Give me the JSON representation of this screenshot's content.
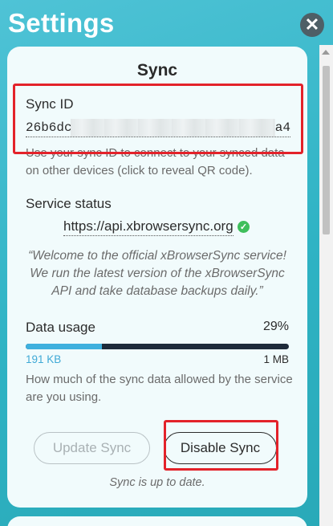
{
  "page_title": "Settings",
  "close_icon": "close-icon",
  "colors": {
    "background": "#2fb3c4",
    "card": "#f1fbfc",
    "accent": "#3fb0de",
    "highlight": "#e3222a",
    "success": "#3fbf5c"
  },
  "sync": {
    "title": "Sync",
    "sync_id_label": "Sync ID",
    "sync_id_start": "26b6dc",
    "sync_id_end": "a4",
    "sync_id_help": "Use your sync ID to connect to your synced data on other devices (click to reveal QR code).",
    "service_status_label": "Service status",
    "service_url": "https://api.xbrowsersync.org",
    "service_message": "“Welcome to the official xBrowserSync service! We run the latest version of the xBrowserSync API and take database backups daily.”",
    "data_usage_label": "Data usage",
    "data_usage_percent": "29%",
    "data_usage_fraction": 0.29,
    "data_usage_used": "191 KB",
    "data_usage_max": "1 MB",
    "data_usage_help": "How much of the sync data allowed by the service are you using.",
    "update_button": "Update Sync",
    "disable_button": "Disable Sync",
    "status": "Sync is up to date."
  }
}
